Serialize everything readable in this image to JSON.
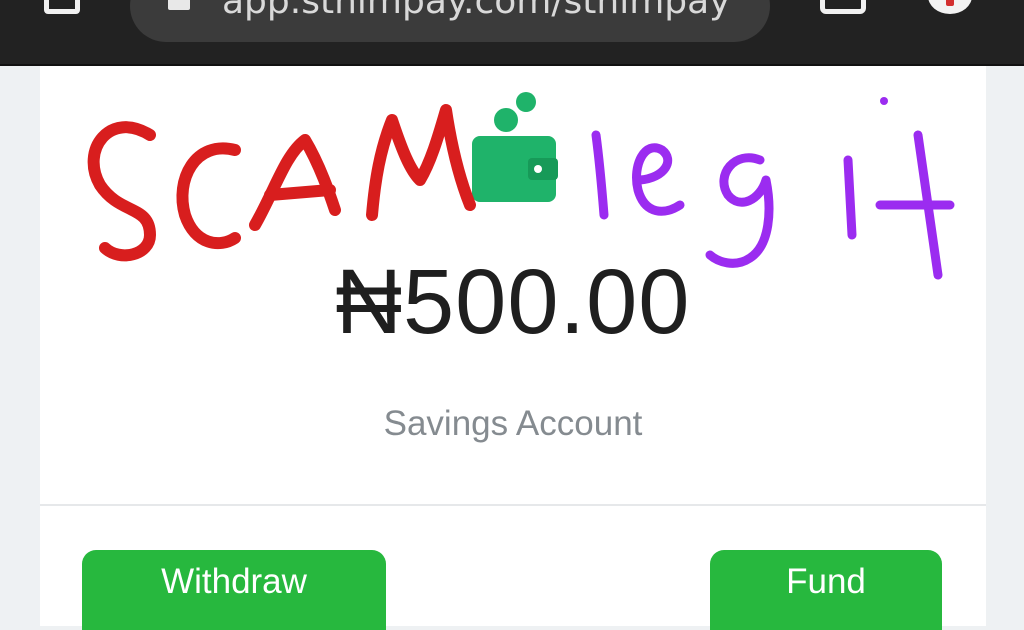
{
  "browser": {
    "url": "app.sthimpay.com/sthimpay"
  },
  "wallet": {
    "balance": "₦500.00",
    "account_type": "Savings Account",
    "accent_color": "#1fb36a"
  },
  "actions": {
    "withdraw_label": "Withdraw",
    "fund_label": "Fund",
    "button_color": "#27b83e"
  },
  "annotations": {
    "left_text": "SCAM",
    "left_color": "#d81e1e",
    "right_text": "legit",
    "right_color": "#9b2cf0"
  }
}
